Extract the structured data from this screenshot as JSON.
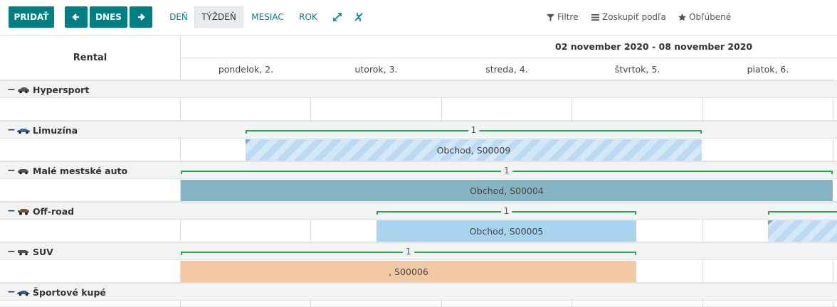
{
  "toolbar": {
    "add_label": "PRIDAŤ",
    "today_label": "DNES",
    "scales": [
      "DEŇ",
      "TÝŽDEŇ",
      "MESIAC",
      "ROK"
    ],
    "active_scale": "TÝŽDEŇ",
    "filters_label": "Filtre",
    "groupby_label": "Zoskupiť podľa",
    "favorites_label": "Obľúbené"
  },
  "gantt": {
    "title": "Rental",
    "range": "02 november 2020 - 08 november 2020",
    "days": [
      "pondelok, 2.",
      "utorok, 3.",
      "streda, 4.",
      "štvrtok, 5.",
      "piatok, 6."
    ],
    "groups": [
      {
        "name": "Hypersport",
        "pills": []
      },
      {
        "name": "Limuzína",
        "count": "1",
        "pills": [
          {
            "label": "Obchod, S00009",
            "style": "hatched"
          }
        ]
      },
      {
        "name": "Malé mestské auto",
        "count": "1",
        "pills": [
          {
            "label": "Obchod, S00004",
            "style": "teal"
          }
        ]
      },
      {
        "name": "Off-road",
        "count": "1",
        "pills": [
          {
            "label": "Obchod, S00005",
            "style": "blue"
          }
        ]
      },
      {
        "name": "SUV",
        "count": "1",
        "pills": [
          {
            "label": ", S00006",
            "style": "orange"
          }
        ]
      },
      {
        "name": "Športové kupé",
        "pills": []
      }
    ]
  },
  "colors": {
    "primary": "#017e84",
    "consolidation": "#28a745",
    "pill_teal": "#85b5c2",
    "pill_blue": "#aad3ee",
    "pill_orange": "#f3c9a5",
    "pill_hatched": "#bcdaf3"
  },
  "icons": [
    "arrow-left-icon",
    "arrow-right-icon",
    "expand-icon",
    "collapse-icon",
    "filter-icon",
    "groupby-icon",
    "star-icon",
    "car-icon"
  ]
}
